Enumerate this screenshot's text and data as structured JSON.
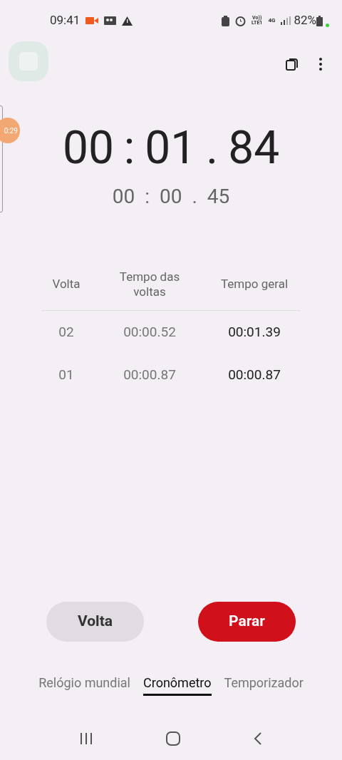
{
  "status_bar": {
    "time": "09:41",
    "volte": "Vo))",
    "lte": "LTE1",
    "network": "4G",
    "battery": "82%"
  },
  "floating_bubble": {
    "text": "0:29"
  },
  "stopwatch": {
    "main": [
      "00",
      ":",
      "01",
      ".",
      "84"
    ],
    "lap": [
      "00",
      ":",
      "00",
      ".",
      "45"
    ]
  },
  "table": {
    "columns": [
      "Volta",
      "Tempo das voltas",
      "Tempo geral"
    ],
    "rows": [
      [
        "02",
        "00:00.52",
        "00:01.39"
      ],
      [
        "01",
        "00:00.87",
        "00:00.87"
      ]
    ]
  },
  "buttons": [
    {
      "label": "Volta",
      "kind": "secondary"
    },
    {
      "label": "Parar",
      "kind": "primary"
    }
  ],
  "tabs": [
    {
      "label": "Relógio mundial",
      "selected": false
    },
    {
      "label": "Cronômetro",
      "selected": true
    },
    {
      "label": "Temporizador",
      "selected": false
    }
  ]
}
